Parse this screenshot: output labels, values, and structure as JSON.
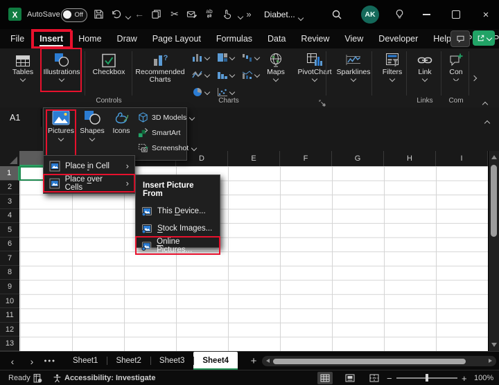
{
  "titlebar": {
    "autosave_label": "AutoSave",
    "autosave_state": "Off",
    "doc_title": "Diabet...",
    "avatar": "AK"
  },
  "menubar": {
    "tabs": [
      {
        "label": "File"
      },
      {
        "label": "Insert",
        "active": true
      },
      {
        "label": "Home"
      },
      {
        "label": "Draw"
      },
      {
        "label": "Page Layout"
      },
      {
        "label": "Formulas"
      },
      {
        "label": "Data"
      },
      {
        "label": "Review"
      },
      {
        "label": "View"
      },
      {
        "label": "Developer"
      },
      {
        "label": "Help"
      },
      {
        "label": "Power Pivot"
      }
    ]
  },
  "ribbon": {
    "tables": "Tables",
    "illustrations": "Illustrations",
    "checkbox": "Checkbox",
    "recommended_charts": "Recommended Charts",
    "maps": "Maps",
    "pivotchart": "PivotChart",
    "sparklines": "Sparklines",
    "filters": "Filters",
    "link": "Link",
    "comments_clipped": "Con",
    "groups": {
      "controls": "Controls",
      "charts": "Charts",
      "links": "Links",
      "comments_clipped": "Com"
    }
  },
  "formula_bar": {
    "name_box": "A1"
  },
  "illustrations_menu": {
    "pictures": "Pictures",
    "shapes": "Shapes",
    "icons": "Icons",
    "models": "3D Models",
    "smartart": "SmartArt",
    "screenshot": "Screenshot"
  },
  "pictures_menu": {
    "items": [
      {
        "pre": "Place ",
        "accel": "i",
        "post": "n Cell",
        "icon": "place-in-cell-icon"
      },
      {
        "pre": "Place ",
        "accel": "o",
        "post": "ver Cells",
        "icon": "place-over-cells-icon",
        "boxed": true
      }
    ]
  },
  "insert_picture_menu": {
    "header": "Insert Picture From",
    "items": [
      {
        "pre": "This ",
        "accel": "D",
        "post": "evice...",
        "icon": "this-device-icon"
      },
      {
        "pre": "",
        "accel": "S",
        "post": "tock Images...",
        "icon": "stock-images-icon"
      },
      {
        "pre": "",
        "accel": "O",
        "post": "nline Pictures...",
        "icon": "online-pictures-icon",
        "boxed": true
      }
    ]
  },
  "grid": {
    "columns": [
      "D",
      "E",
      "F",
      "G",
      "H",
      "I"
    ],
    "rows": [
      {
        "label": "1",
        "active": true
      },
      {
        "label": "2"
      },
      {
        "label": "3"
      },
      {
        "label": "4"
      },
      {
        "label": "5"
      },
      {
        "label": "6"
      },
      {
        "label": "7"
      },
      {
        "label": "8"
      },
      {
        "label": "9"
      },
      {
        "label": "10"
      },
      {
        "label": "11"
      },
      {
        "label": "12"
      },
      {
        "label": "13"
      }
    ]
  },
  "sheet_bar": {
    "tabs": [
      {
        "label": "Sheet1"
      },
      {
        "label": "Sheet2"
      },
      {
        "label": "Sheet3"
      },
      {
        "label": "Sheet4",
        "active": true
      }
    ]
  },
  "status_bar": {
    "ready": "Ready",
    "accessibility": "Accessibility: Investigate",
    "zoom_level": "100%"
  }
}
